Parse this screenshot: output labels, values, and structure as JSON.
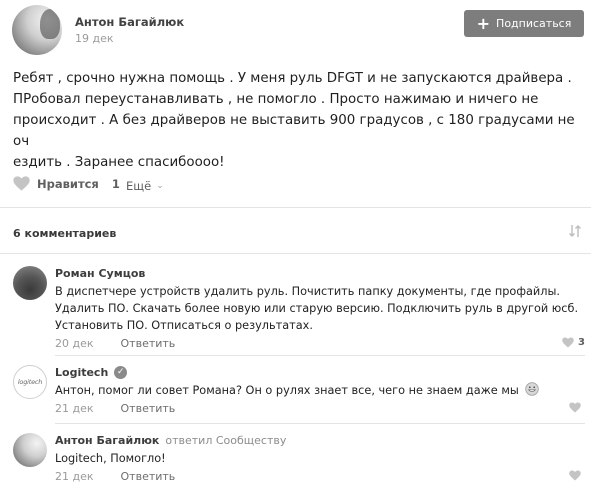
{
  "post": {
    "author": "Антон Багайлюк",
    "date": "19 дек",
    "subscribe_label": "Подписаться",
    "text": "Ребят , срочно нужна помощь . У меня руль DFGT и не запускаются драйвера .\nПРобовал переустанавливать , не помогло . Просто нажимаю и ничего не\nпроисходит . А без драйверов не выставить 900 градусов , с 180 градусами не оч\nездить . Заранее спасибоооо!",
    "like_label": "Нравится",
    "like_count": "1",
    "more_label": "Ещё"
  },
  "comments_header": {
    "count_label": "6 комментариев"
  },
  "comments": [
    {
      "author": "Роман Сумцов",
      "text": "В диспетчере устройств удалить руль. Почистить папку документы, где профайлы. Удалить ПО. Скачать более новую или старую версию. Подключить руль в другой юсб. Установить ПО. Отписаться о результатах.",
      "date": "20 дек",
      "reply_label": "Ответить",
      "likes": "3"
    },
    {
      "author": "Logitech",
      "avatar_text": "logitech",
      "text": "Антон, помог ли совет Романа? Он о рулях знает все, чего не знаем даже мы",
      "date": "21 дек",
      "reply_label": "Ответить",
      "likes": ""
    },
    {
      "author": "Антон Багайлюк",
      "replied_to": "ответил Сообществу",
      "text": "Logitech, Помогло!",
      "date": "21 дек",
      "reply_label": "Ответить",
      "likes": ""
    }
  ],
  "icons": {
    "like": "heart-icon",
    "more": "chevron-down-icon",
    "sort": "sort-icon",
    "verified": "verified-check-icon",
    "emoji": "grinning-emoji-icon",
    "subscribe": "plus-icon"
  },
  "colors": {
    "button_bg": "#7d7d7d",
    "heart": "#c4c4c4",
    "divider": "#e4e4e4"
  }
}
